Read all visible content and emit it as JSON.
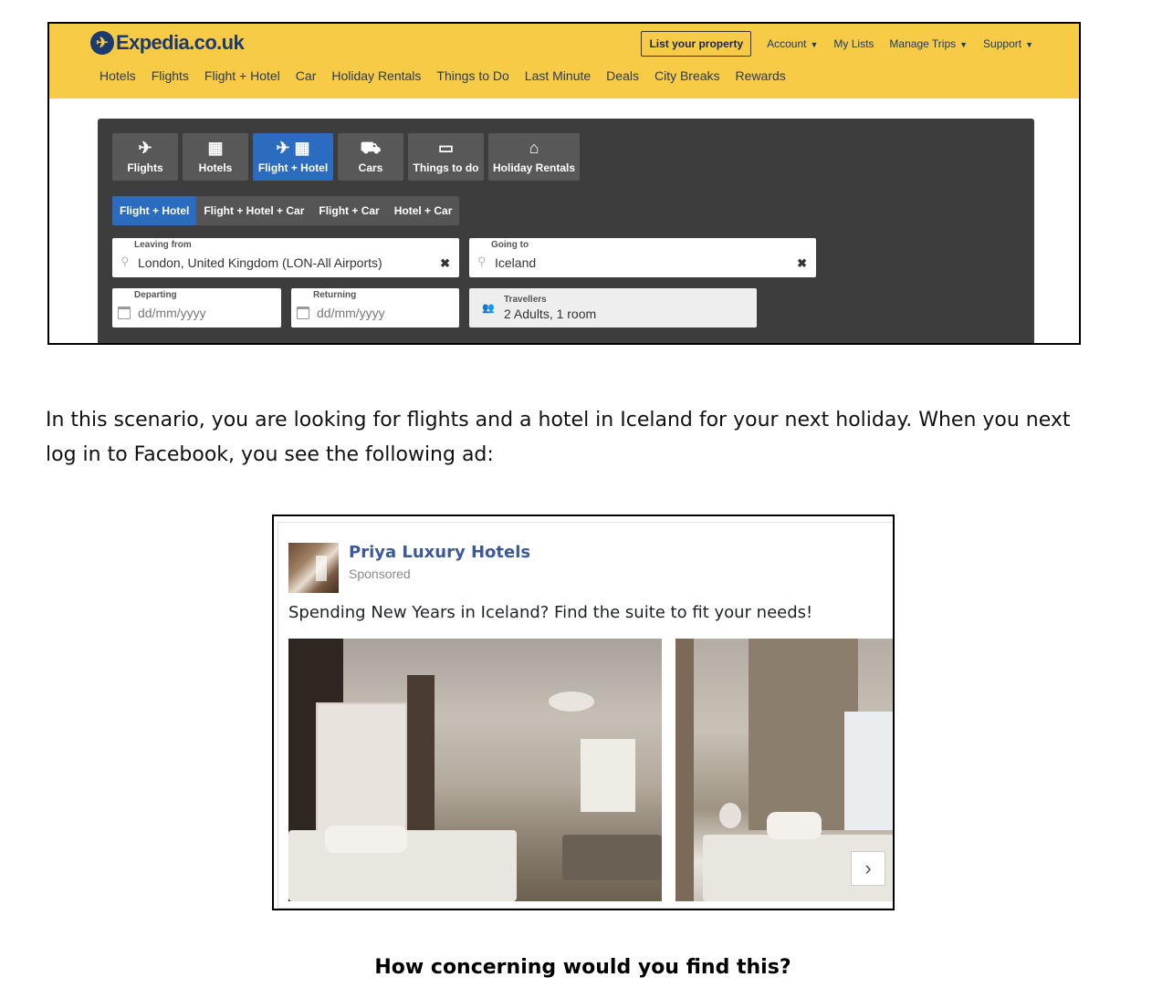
{
  "expedia": {
    "logo": "Expedia.co.uk",
    "list_property": "List your property",
    "top_links": [
      "Account",
      "My Lists",
      "Manage Trips",
      "Support"
    ],
    "nav": [
      "Hotels",
      "Flights",
      "Flight + Hotel",
      "Car",
      "Holiday Rentals",
      "Things to Do",
      "Last Minute",
      "Deals",
      "City Breaks",
      "Rewards"
    ],
    "tabs": [
      {
        "label": "Flights",
        "icon": "plane-icon",
        "glyph": "✈"
      },
      {
        "label": "Hotels",
        "icon": "building-icon",
        "glyph": "🏢"
      },
      {
        "label": "Flight + Hotel",
        "icon": "plane-building-icon",
        "glyph": "✈ ▦",
        "active": true
      },
      {
        "label": "Cars",
        "icon": "car-icon",
        "glyph": "🚘"
      },
      {
        "label": "Things to do",
        "icon": "ticket-icon",
        "glyph": "🎫"
      },
      {
        "label": "Holiday Rentals",
        "icon": "house-icon",
        "glyph": "⌂"
      }
    ],
    "subtabs": [
      "Flight + Hotel",
      "Flight + Hotel + Car",
      "Flight + Car",
      "Hotel + Car"
    ],
    "leaving_from": {
      "label": "Leaving from",
      "value": "London, United Kingdom (LON-All Airports)"
    },
    "going_to": {
      "label": "Going to",
      "value": "Iceland"
    },
    "departing": {
      "label": "Departing",
      "placeholder": "dd/mm/yyyy"
    },
    "returning": {
      "label": "Returning",
      "placeholder": "dd/mm/yyyy"
    },
    "travellers": {
      "label": "Travellers",
      "value": "2 Adults, 1 room"
    },
    "colors": {
      "header": "#f7cb45",
      "brand": "#1c3a6e",
      "active_tab": "#2b6cc0"
    }
  },
  "scenario_text": "In this scenario, you are looking for flights and a hotel in Iceland for your next holiday. When you next log in to Facebook, you see the following ad:",
  "ad": {
    "page_name": "Priya Luxury Hotels",
    "sponsored": "Sponsored",
    "text": "Spending New Years in Iceland? Find the suite to fit your needs!",
    "next_icon": "chevron-right-icon"
  },
  "question": "How concerning would you find this?"
}
